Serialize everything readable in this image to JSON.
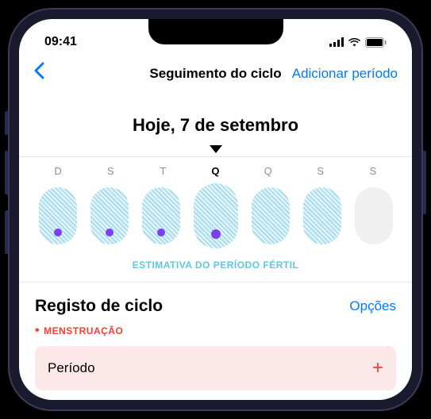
{
  "status": {
    "time": "09:41"
  },
  "nav": {
    "title": "Seguimento do ciclo",
    "action": "Adicionar período"
  },
  "dateHeader": "Hoje, 7 de setembro",
  "days": [
    {
      "label": "D",
      "active": false,
      "fertile": true,
      "dot": true
    },
    {
      "label": "S",
      "active": false,
      "fertile": true,
      "dot": true
    },
    {
      "label": "T",
      "active": false,
      "fertile": true,
      "dot": true
    },
    {
      "label": "Q",
      "active": true,
      "fertile": true,
      "dot": true
    },
    {
      "label": "Q",
      "active": false,
      "fertile": true,
      "dot": false
    },
    {
      "label": "S",
      "active": false,
      "fertile": true,
      "dot": false
    },
    {
      "label": "S",
      "active": false,
      "fertile": false,
      "dot": false
    }
  ],
  "fertileLabel": "ESTIMATIVA DO PERÍODO FÉRTIL",
  "cycleLog": {
    "title": "Registo de ciclo",
    "options": "Opções",
    "subsection": "MENSTRUAÇÃO",
    "item": "Período"
  }
}
